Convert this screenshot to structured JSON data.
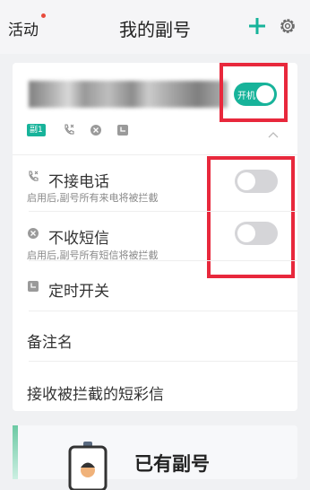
{
  "header": {
    "left_label": "活动",
    "title": "我的副号"
  },
  "number_card": {
    "power_toggle": {
      "label": "开机",
      "on": true
    },
    "badge": "副1",
    "rows": [
      {
        "title": "不接电话",
        "subtitle": "启用后,副号所有来电将被拦截",
        "toggle_on": false
      },
      {
        "title": "不收短信",
        "subtitle": "启用后,副号所有短信将被拦截",
        "toggle_on": false
      }
    ],
    "schedule_label": "定时开关",
    "remark_label": "备注名",
    "blocked_messages_label": "接收被拦截的短彩信"
  },
  "bottom_card": {
    "title": "已有副号"
  },
  "colors": {
    "accent": "#17b39a",
    "highlight_box": "#e8283c",
    "notice_dot": "#e84b3c"
  }
}
